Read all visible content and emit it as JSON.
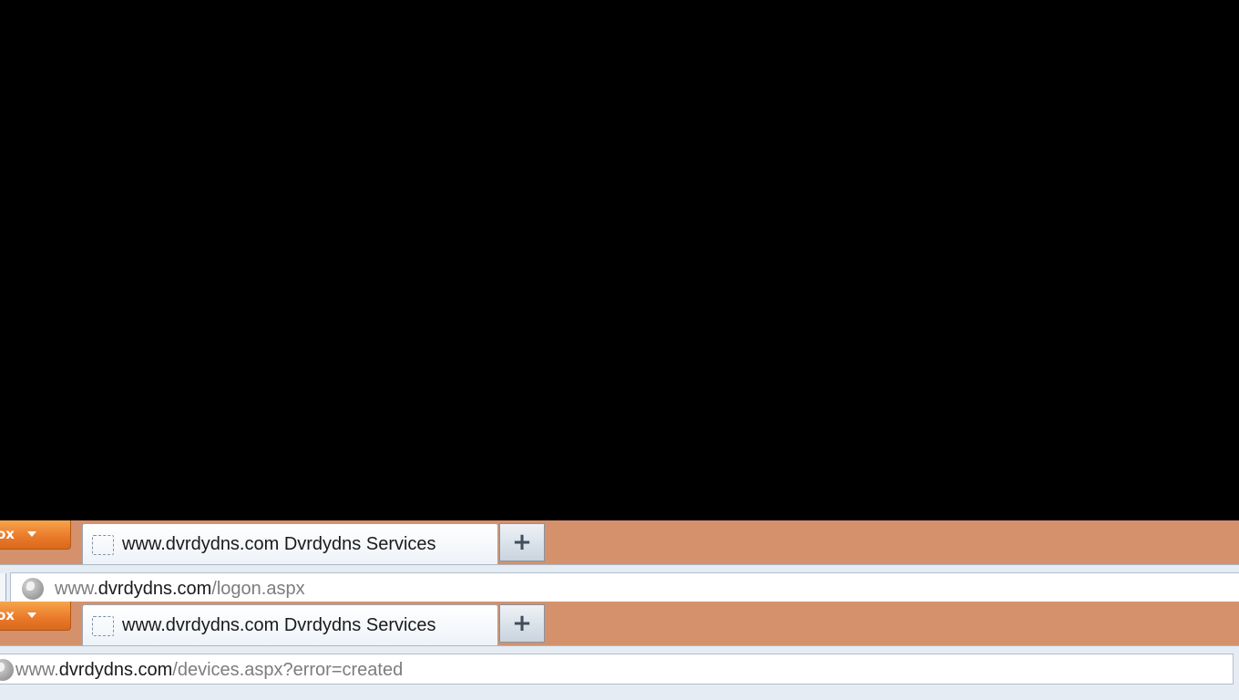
{
  "windows": [
    {
      "app_menu_label": "ox",
      "tab_title": "www.dvrdydns.com Dvrdydns Services",
      "new_tab_label": "+",
      "url_prefix": "www.",
      "url_host": "dvrdydns.com",
      "url_path": "/logon.aspx"
    },
    {
      "app_menu_label": "ox",
      "tab_title": "www.dvrdydns.com Dvrdydns Services",
      "new_tab_label": "+",
      "url_prefix": "www.",
      "url_host": "dvrdydns.com",
      "url_path": "/devices.aspx?error=created"
    }
  ],
  "colors": {
    "tabstrip": "#d4916b",
    "app_menu": "#e9782a",
    "desktop": "#000000"
  }
}
